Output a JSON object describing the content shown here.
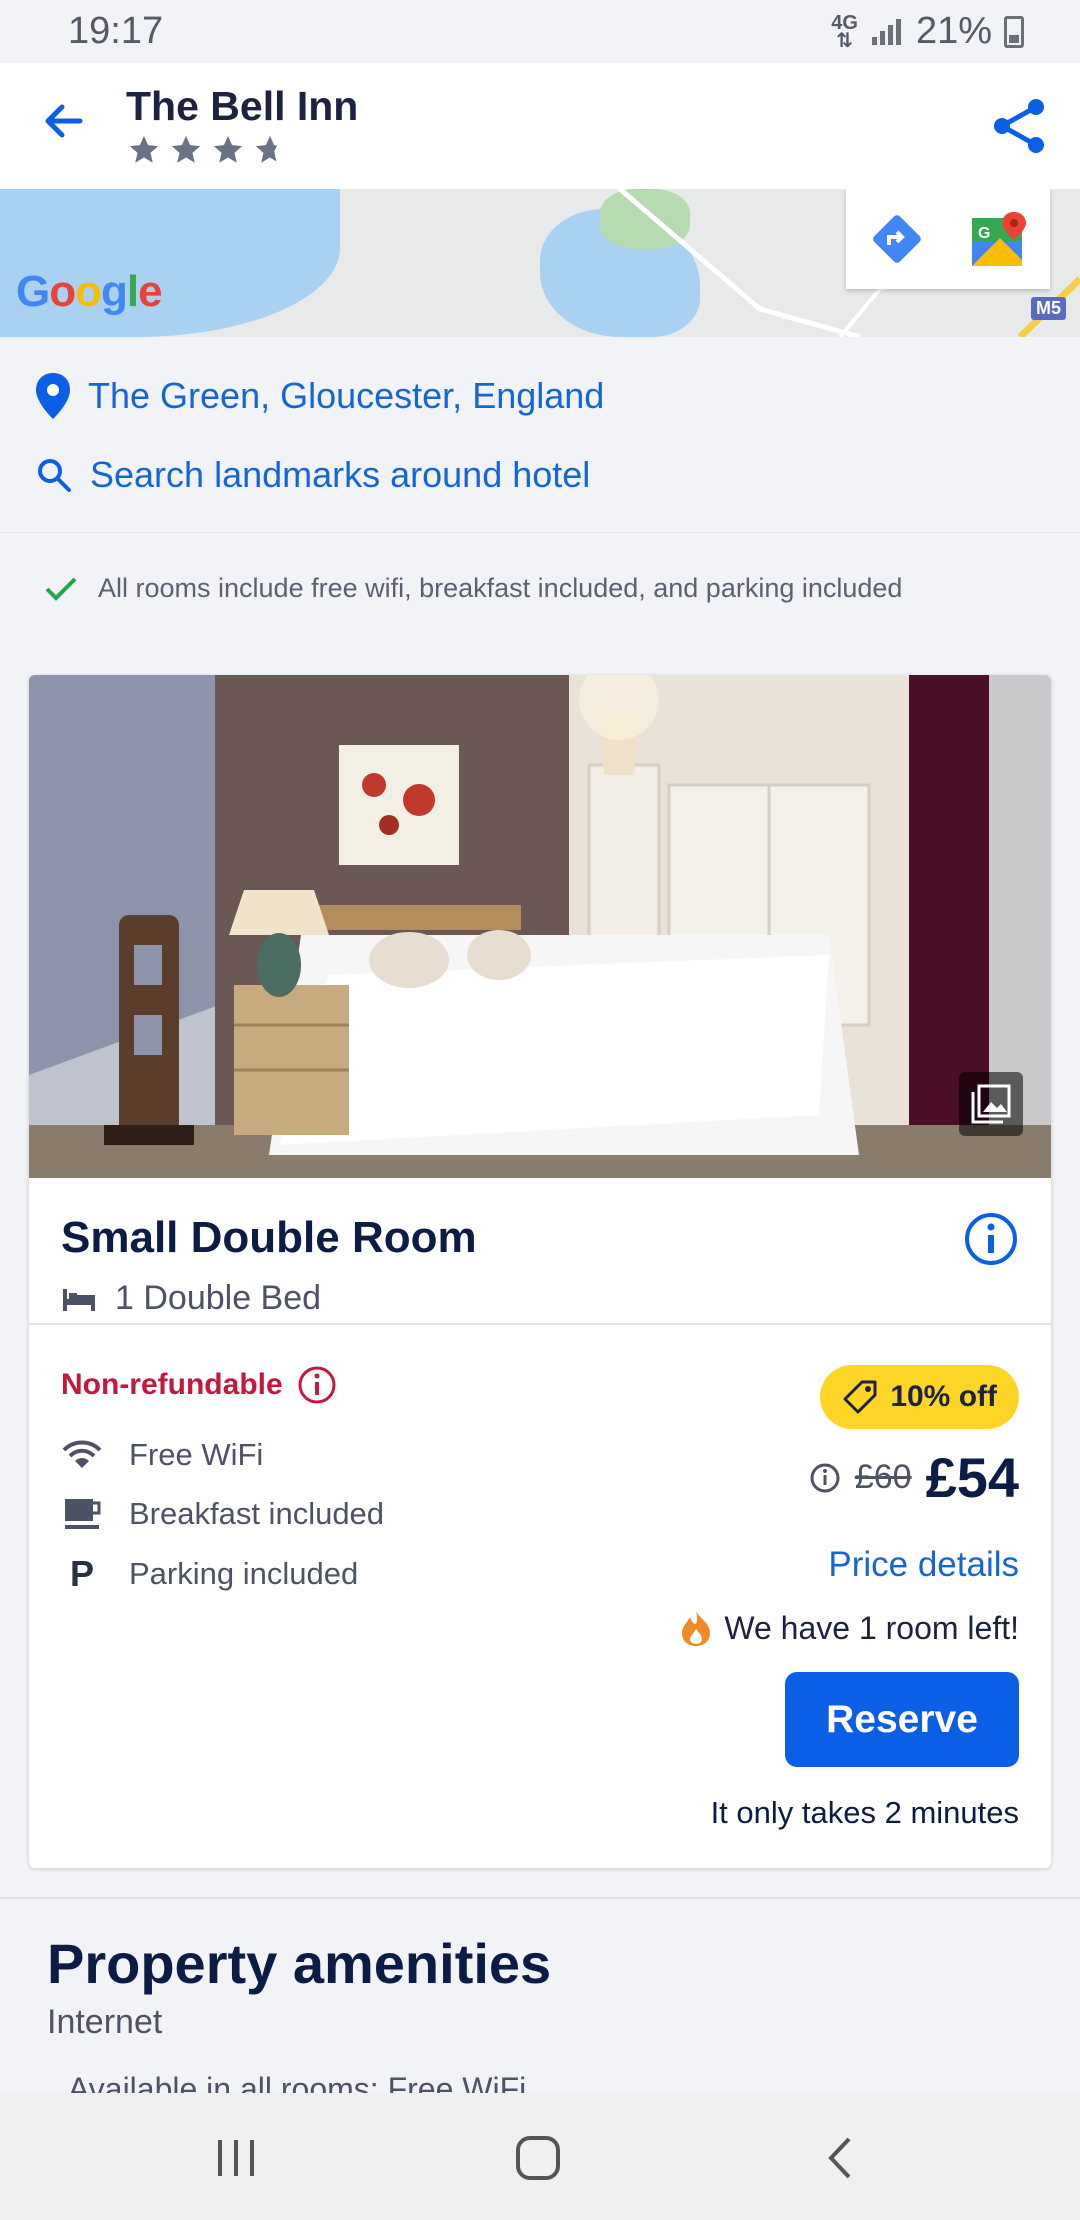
{
  "status_bar": {
    "time": "19:17",
    "network": "4G",
    "battery": "21%"
  },
  "header": {
    "title": "The Bell Inn",
    "stars": 3.5
  },
  "map": {
    "logo": "Google",
    "motorway": "M5"
  },
  "address": {
    "text": "The Green, Gloucester, England"
  },
  "search": {
    "label": "Search landmarks around hotel"
  },
  "included_note": "All rooms include free wifi, breakfast included, and parking included",
  "room": {
    "name": "Small Double Room",
    "bed": "1 Double Bed",
    "refund_policy": "Non-refundable",
    "features": [
      {
        "label": "Free WiFi",
        "icon": "wifi-icon"
      },
      {
        "label": "Breakfast included",
        "icon": "coffee-icon"
      },
      {
        "label": "Parking included",
        "icon": "parking-icon"
      }
    ],
    "discount": "10% off",
    "old_price": "£60",
    "price": "£54",
    "price_details": "Price details",
    "rooms_left": "We have 1 room left!",
    "reserve": "Reserve",
    "takes": "It only takes 2 minutes"
  },
  "amenities": {
    "title": "Property amenities",
    "subtitle": "Internet",
    "first_line": "Available in all rooms: Free WiFi"
  },
  "colors": {
    "accent": "#0b5fe6",
    "link": "#1565d8",
    "badge": "#fdd526",
    "alert": "#c5183c",
    "navy": "#0d1c44"
  }
}
